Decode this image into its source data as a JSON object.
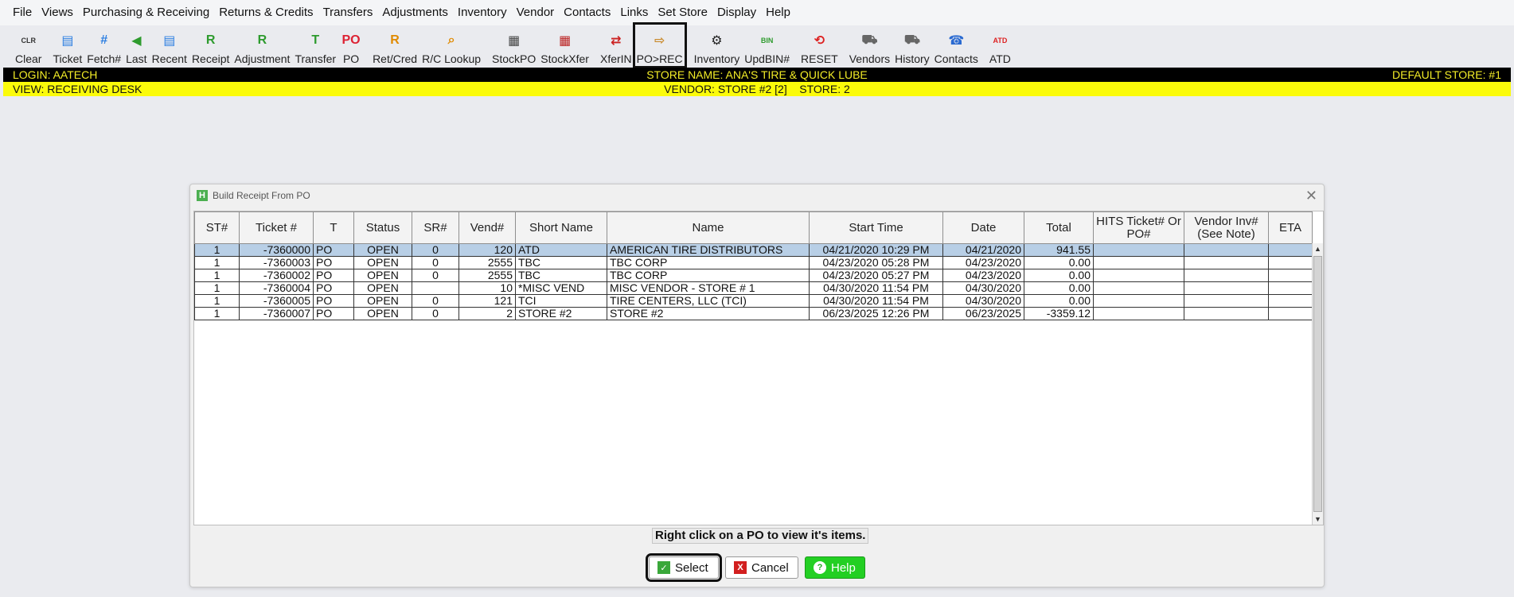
{
  "menu": [
    "File",
    "Views",
    "Purchasing & Receiving",
    "Returns & Credits",
    "Transfers",
    "Adjustments",
    "Inventory",
    "Vendor",
    "Contacts",
    "Links",
    "Set Store",
    "Display",
    "Help"
  ],
  "toolbar": [
    {
      "label": "Clear",
      "icon": "clear-icon",
      "name": "clear"
    },
    {
      "label": "Ticket",
      "icon": "ticket-icon",
      "name": "ticket"
    },
    {
      "label": "Fetch#",
      "icon": "fetch-icon",
      "name": "fetch"
    },
    {
      "label": "Last",
      "icon": "last-icon",
      "name": "last"
    },
    {
      "label": "Recent",
      "icon": "recent-icon",
      "name": "recent"
    },
    {
      "label": "Receipt",
      "icon": "receipt-icon",
      "name": "receipt"
    },
    {
      "label": "Adjustment",
      "icon": "adjustment-icon",
      "name": "adjustment"
    },
    {
      "label": "Transfer",
      "icon": "transfer-icon",
      "name": "transfer"
    },
    {
      "label": "PO",
      "icon": "po-icon",
      "name": "po"
    },
    {
      "label": "Ret/Cred",
      "icon": "ret-cred-icon",
      "name": "ret-cred"
    },
    {
      "label": "R/C Lookup",
      "icon": "rc-lookup-icon",
      "name": "rc-lookup"
    },
    {
      "label": "StockPO",
      "icon": "stockpo-icon",
      "name": "stockpo"
    },
    {
      "label": "StockXfer",
      "icon": "stockxfer-icon",
      "name": "stockxfer"
    },
    {
      "label": "XferIN",
      "icon": "xferin-icon",
      "name": "xferin"
    },
    {
      "label": "PO>REC",
      "icon": "po-rec-icon",
      "name": "po-rec",
      "selected": true
    },
    {
      "label": "Inventory",
      "icon": "inventory-icon",
      "name": "inventory"
    },
    {
      "label": "UpdBIN#",
      "icon": "updbin-icon",
      "name": "updbin"
    },
    {
      "label": "RESET",
      "icon": "reset-icon",
      "name": "reset"
    },
    {
      "label": "Vendors",
      "icon": "vendors-icon",
      "name": "vendors"
    },
    {
      "label": "History",
      "icon": "history-icon",
      "name": "history"
    },
    {
      "label": "Contacts",
      "icon": "contacts-icon",
      "name": "contacts"
    },
    {
      "label": "ATD",
      "icon": "atd-icon",
      "name": "atd"
    }
  ],
  "status": {
    "login": "LOGIN: AATECH",
    "store_name": "STORE NAME: ANA'S TIRE & QUICK LUBE",
    "default_store": "DEFAULT STORE: #1",
    "view": "VIEW: RECEIVING DESK",
    "vendor_store": "VENDOR: STORE #2 [2]    STORE: 2"
  },
  "dialog": {
    "title": "Build Receipt From PO",
    "columns": [
      "ST#",
      "Ticket #",
      "T",
      "Status",
      "SR#",
      "Vend#",
      "Short Name",
      "Name",
      "Start Time",
      "Date",
      "Total",
      "HITS Ticket# Or PO#",
      "Vendor Inv# (See Note)",
      "ETA"
    ],
    "rows": [
      [
        "1",
        "-7360000",
        "PO",
        "OPEN",
        "0",
        "120",
        "ATD",
        "AMERICAN TIRE DISTRIBUTORS",
        "04/21/2020 10:29 PM",
        "04/21/2020",
        "941.55",
        "",
        "",
        ""
      ],
      [
        "1",
        "-7360003",
        "PO",
        "OPEN",
        "0",
        "2555",
        "TBC",
        "TBC CORP",
        "04/23/2020 05:28 PM",
        "04/23/2020",
        "0.00",
        "",
        "",
        ""
      ],
      [
        "1",
        "-7360002",
        "PO",
        "OPEN",
        "0",
        "2555",
        "TBC",
        "TBC CORP",
        "04/23/2020 05:27 PM",
        "04/23/2020",
        "0.00",
        "",
        "",
        ""
      ],
      [
        "1",
        "-7360004",
        "PO",
        "OPEN",
        "",
        "10",
        "*MISC VEND",
        "MISC VENDOR - STORE # 1",
        "04/30/2020 11:54 PM",
        "04/30/2020",
        "0.00",
        "",
        "",
        ""
      ],
      [
        "1",
        "-7360005",
        "PO",
        "OPEN",
        "0",
        "121",
        "TCI",
        "TIRE CENTERS, LLC (TCI)",
        "04/30/2020 11:54 PM",
        "04/30/2020",
        "0.00",
        "",
        "",
        ""
      ],
      [
        "1",
        "-7360007",
        "PO",
        "OPEN",
        "0",
        "2",
        "STORE #2",
        "STORE #2",
        "06/23/2025 12:26 PM",
        "06/23/2025",
        "-3359.12",
        "",
        "",
        ""
      ]
    ],
    "hint": "Right click on a PO to view it's items.",
    "select_label": "Select",
    "cancel_label": "Cancel",
    "help_label": "Help"
  }
}
